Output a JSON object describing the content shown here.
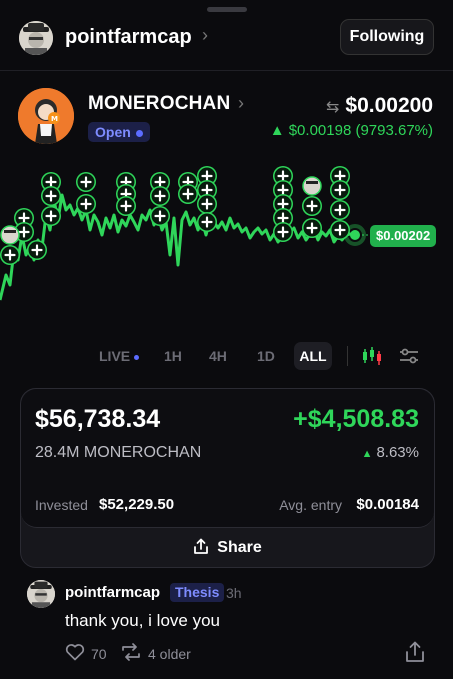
{
  "header": {
    "username": "pointfarmcap",
    "follow_label": "Following"
  },
  "token": {
    "name": "MONEROCHAN",
    "status": "Open",
    "price": "$0.00200",
    "change": "▲ $0.00198 (9793.67%)",
    "current_price_tag": "$0.00202",
    "colors": {
      "positive": "#2fd65a",
      "accent": "#5c6cff",
      "avatar_bg": "#ef7a2c"
    }
  },
  "timeframes": {
    "items": [
      "LIVE",
      "1H",
      "4H",
      "1D",
      "ALL"
    ],
    "selected": "ALL"
  },
  "position": {
    "value": "$56,738.34",
    "pnl": "+$4,508.83",
    "holding": "28.4M MONEROCHAN",
    "pnl_pct": "8.63%",
    "invested_label": "Invested",
    "invested": "$52,229.50",
    "avg_entry_label": "Avg. entry",
    "avg_entry": "$0.00184",
    "share_label": "Share"
  },
  "post": {
    "username": "pointfarmcap",
    "tag": "Thesis",
    "time": "3h",
    "text": "thank you, i love you",
    "likes": "70",
    "older": "4 older"
  },
  "icons": [
    "chevron-right-icon",
    "swap-icon",
    "candlestick-icon",
    "filter-icon",
    "share-icon",
    "heart-icon",
    "repost-icon",
    "upload-icon",
    "buy-marker-icon"
  ]
}
